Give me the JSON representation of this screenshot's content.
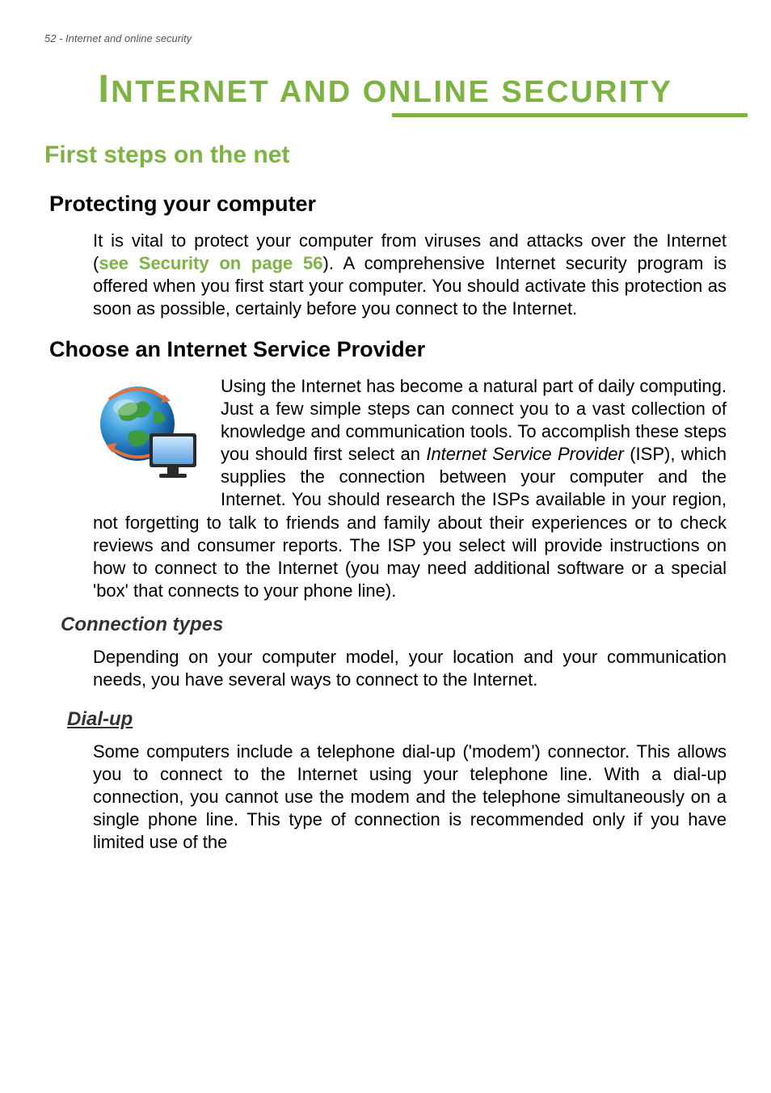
{
  "page": {
    "header": "52 - Internet and online security",
    "mainTitle": "NTERNET AND ONLINE SECURITY",
    "mainTitleCap": "I"
  },
  "sections": {
    "firstSteps": {
      "title": "First steps on the net"
    },
    "protecting": {
      "title": "Protecting your computer",
      "para_before_link": "It is vital to protect your computer from viruses and attacks over the Internet (",
      "link_text": "see Security on page 56",
      "para_after_link": "). A comprehensive Internet security program is offered when you first start your computer. You should activate this protection as soon as possible, certainly before you connect to the Internet."
    },
    "isp": {
      "title": "Choose an Internet Service Provider",
      "para_before_italic": "Using the Internet has become a natural part of daily computing. Just a few simple steps can connect you to a vast collection of knowledge and communication tools. To accomplish these steps you should first select an ",
      "italic_term": "Internet Service Provider",
      "para_after_italic": " (ISP), which supplies the connection between your computer and the Internet. You should research the ISPs available in your region, not forgetting to talk to friends and family about their experiences or to check reviews and consumer reports. The ISP you select will provide instructions on how to connect to the Internet (you may need additional software or a special 'box' that connects to your phone line)."
    },
    "connectionTypes": {
      "title": "Connection types",
      "para": "Depending on your computer model, your location and your communication needs, you have several ways to connect to the Internet."
    },
    "dialup": {
      "title": "Dial-up",
      "para": "Some computers include a telephone dial-up ('modem') connector. This allows you to connect to the Internet using your telephone line. With a dial-up connection, you cannot use the modem and the telephone simultaneously on a single phone line. This type of connection is recommended only if you have limited use of the"
    }
  },
  "icons": {
    "globe": "globe-monitor-icon"
  }
}
